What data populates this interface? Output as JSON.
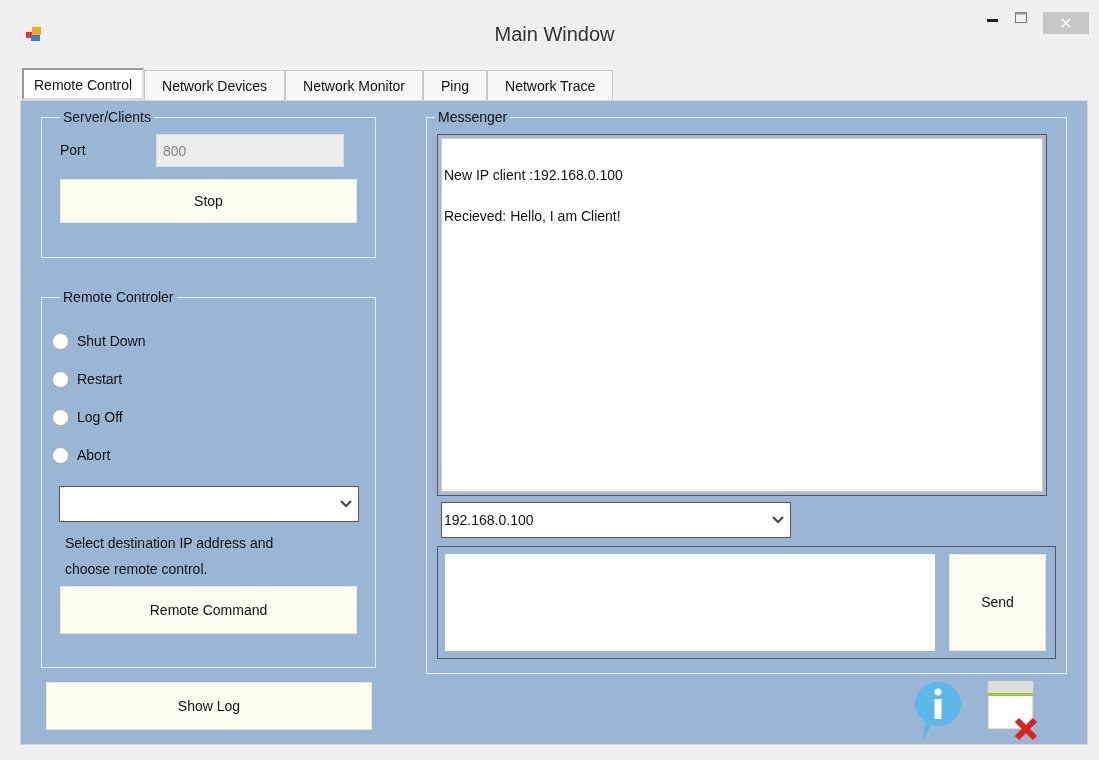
{
  "window": {
    "title": "Main Window"
  },
  "tabs": [
    {
      "label": "Remote Control",
      "selected": true
    },
    {
      "label": "Network Devices",
      "selected": false
    },
    {
      "label": "Network Monitor",
      "selected": false
    },
    {
      "label": "Ping",
      "selected": false
    },
    {
      "label": "Network Trace",
      "selected": false
    }
  ],
  "server_clients": {
    "title": "Server/Clients",
    "port_label": "Port",
    "port_value": "800",
    "port_disabled": true,
    "button": "Stop"
  },
  "remote_controller": {
    "title": "Remote Controler",
    "options": [
      {
        "label": "Shut Down",
        "selected": false
      },
      {
        "label": "Restart",
        "selected": false
      },
      {
        "label": "Log Off",
        "selected": false
      },
      {
        "label": "Abort",
        "selected": false
      }
    ],
    "hint": "Select destination IP address and choose remote control.",
    "button": "Remote Command"
  },
  "show_log_button": "Show Log",
  "messenger": {
    "title": "Messenger",
    "messages": [
      "New IP client :192.168.0.100",
      "Recieved: Hello, I am Client!"
    ],
    "destination": "192.168.0.100",
    "send_button": "Send"
  }
}
